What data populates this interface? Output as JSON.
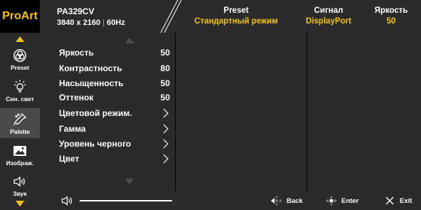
{
  "brand": "ProArt",
  "header": {
    "model": "PA329CV",
    "resolution": "3840 x 2160",
    "refresh": "60Hz",
    "preset": {
      "title": "Preset",
      "value": "Стандартный режим"
    },
    "signal": {
      "title": "Сигнал",
      "value": "DisplayPort"
    },
    "brightness": {
      "title": "Яркость",
      "value": "50"
    }
  },
  "sidebar": {
    "items": [
      {
        "label": "Preset",
        "icon": "palette-circles-icon",
        "active": false
      },
      {
        "label": "Син. свет",
        "icon": "bulb-icon",
        "active": false
      },
      {
        "label": "Palette",
        "icon": "dropper-icon",
        "active": true
      },
      {
        "label": "Изображ.",
        "icon": "image-icon",
        "active": false
      },
      {
        "label": "Звук",
        "icon": "speaker-icon",
        "active": false
      }
    ]
  },
  "menu": {
    "items": [
      {
        "label": "Яркость",
        "value": "50"
      },
      {
        "label": "Контрастность",
        "value": "80"
      },
      {
        "label": "Насыщенность",
        "value": "50"
      },
      {
        "label": "Оттенок",
        "value": "50"
      },
      {
        "label": "Цветовой режим.",
        "value": null
      },
      {
        "label": "Гамма",
        "value": null
      },
      {
        "label": "Уровень черного",
        "value": null
      },
      {
        "label": "Цвет",
        "value": null
      }
    ]
  },
  "footer": {
    "volume_level": 1.0,
    "back_label": "Back",
    "enter_label": "Enter",
    "exit_label": "Exit"
  },
  "colors": {
    "accent": "#f5c400",
    "panel": "#2b2b2b",
    "active_item": "#4a4a4a",
    "background": "#000000"
  }
}
